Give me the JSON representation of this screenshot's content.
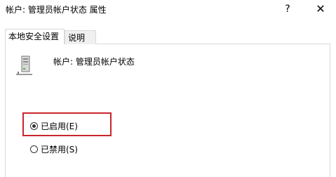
{
  "window": {
    "title": "帐户: 管理员帐户状态 属性",
    "help_glyph": "?",
    "close_glyph": "✕"
  },
  "tabs": [
    {
      "label": "本地安全设置",
      "active": true
    },
    {
      "label": "说明",
      "active": false
    }
  ],
  "policy": {
    "icon": "computer-tower-icon",
    "name": "帐户: 管理员帐户状态"
  },
  "options": [
    {
      "label": "已启用(E)",
      "selected": true
    },
    {
      "label": "已禁用(S)",
      "selected": false
    }
  ],
  "colors": {
    "highlight": "#c9252c"
  }
}
